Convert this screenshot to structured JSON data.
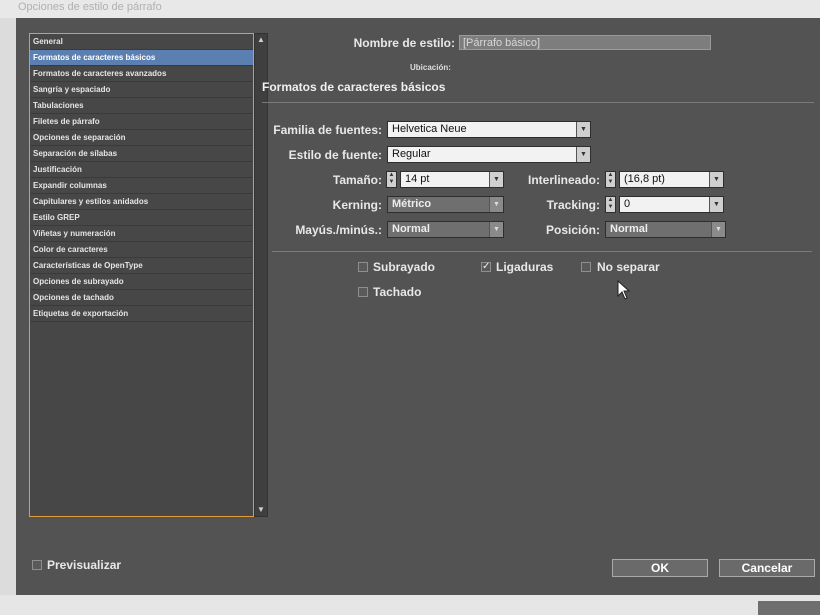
{
  "window": {
    "title": "Opciones de estilo de párrafo"
  },
  "sidebar": {
    "items": [
      {
        "label": "General",
        "selected": false
      },
      {
        "label": "Formatos de caracteres básicos",
        "selected": true
      },
      {
        "label": "Formatos de caracteres avanzados",
        "selected": false
      },
      {
        "label": "Sangría y espaciado",
        "selected": false
      },
      {
        "label": "Tabulaciones",
        "selected": false
      },
      {
        "label": "Filetes de párrafo",
        "selected": false
      },
      {
        "label": "Opciones de separación",
        "selected": false
      },
      {
        "label": "Separación de sílabas",
        "selected": false
      },
      {
        "label": "Justificación",
        "selected": false
      },
      {
        "label": "Expandir columnas",
        "selected": false
      },
      {
        "label": "Capitulares y estilos anidados",
        "selected": false
      },
      {
        "label": "Estilo GREP",
        "selected": false
      },
      {
        "label": "Viñetas y numeración",
        "selected": false
      },
      {
        "label": "Color de caracteres",
        "selected": false
      },
      {
        "label": "Características de OpenType",
        "selected": false
      },
      {
        "label": "Opciones de subrayado",
        "selected": false
      },
      {
        "label": "Opciones de tachado",
        "selected": false
      },
      {
        "label": "Etiquetas de exportación",
        "selected": false
      }
    ]
  },
  "header": {
    "style_name_label": "Nombre de estilo:",
    "style_name_value": "[Párrafo básico]",
    "location_label": "Ubicación:"
  },
  "section": {
    "title": "Formatos de caracteres básicos"
  },
  "form": {
    "font_family_label": "Familia de fuentes:",
    "font_family_value": "Helvetica Neue",
    "font_style_label": "Estilo de fuente:",
    "font_style_value": "Regular",
    "size_label": "Tamaño:",
    "size_value": "14 pt",
    "leading_label": "Interlineado:",
    "leading_value": "(16,8 pt)",
    "kerning_label": "Kerning:",
    "kerning_value": "Métrico",
    "tracking_label": "Tracking:",
    "tracking_value": "0",
    "case_label": "Mayús./minús.:",
    "case_value": "Normal",
    "position_label": "Posición:",
    "position_value": "Normal"
  },
  "checkboxes": {
    "underline": {
      "label": "Subrayado",
      "checked": false
    },
    "ligatures": {
      "label": "Ligaduras",
      "checked": true
    },
    "no_break": {
      "label": "No separar",
      "checked": false
    },
    "strikethrough": {
      "label": "Tachado",
      "checked": false
    }
  },
  "footer": {
    "preview_label": "Previsualizar",
    "ok_label": "OK",
    "cancel_label": "Cancelar"
  }
}
